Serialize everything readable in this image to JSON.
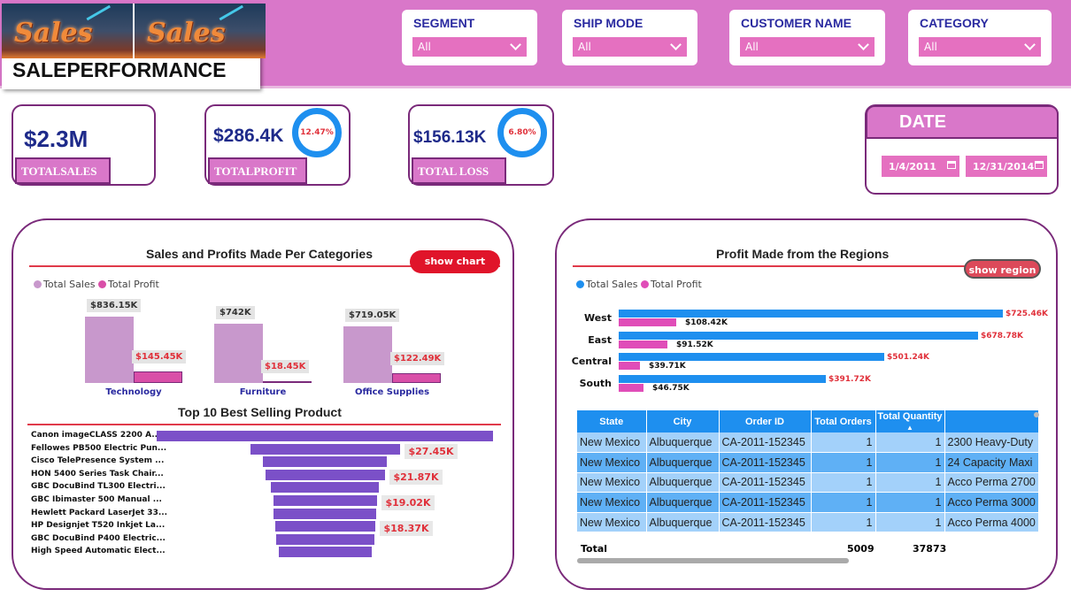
{
  "header": {
    "logo_word": "Sales",
    "title": "SALEPERFORMANCE",
    "slicers": [
      {
        "label": "SEGMENT",
        "value": "All"
      },
      {
        "label": "SHIP MODE",
        "value": "All"
      },
      {
        "label": "CUSTOMER NAME",
        "value": "All"
      },
      {
        "label": "CATEGORY",
        "value": "All"
      }
    ]
  },
  "kpis": {
    "sales": {
      "value": "$2.3M",
      "label": "TOTALSALES"
    },
    "profit": {
      "value": "$286.4K",
      "label": "TOTALPROFIT",
      "pct": "12.47%"
    },
    "loss": {
      "value": "$156.13K",
      "label": "TOTAL LOSS",
      "pct": "6.80%"
    }
  },
  "date": {
    "title": "DATE",
    "start": "1/4/2011",
    "end": "12/31/2014"
  },
  "category_panel": {
    "title": "Sales and Profits Made Per Categories",
    "button": "show chart",
    "funnel_title": "Top 10 Best Selling Product"
  },
  "region_panel": {
    "title": "Profit Made from the Regions",
    "button": "show region"
  },
  "colors": {
    "accent": "#d977c9",
    "sales_cat": "#c898cc",
    "profit_cat": "#d94fa8",
    "sales_region": "#1e8fef",
    "profit_region": "#e04db8",
    "funnel": "#7b50c8"
  },
  "chart_data": [
    {
      "type": "bar",
      "title": "Sales and Profits Made Per Categories",
      "categories": [
        "Technology",
        "Furniture",
        "Office Supplies"
      ],
      "series": [
        {
          "name": "Total Sales",
          "values": [
            836150,
            742000,
            719050
          ],
          "labels": [
            "$836.15K",
            "$742K",
            "$719.05K"
          ]
        },
        {
          "name": "Total Profit",
          "values": [
            145450,
            18450,
            122490
          ],
          "labels": [
            "$145.45K",
            "$18.45K",
            "$122.49K"
          ]
        }
      ],
      "legend": "top-left"
    },
    {
      "type": "bar",
      "title": "Profit Made from the Regions",
      "orientation": "horizontal",
      "categories": [
        "West",
        "East",
        "Central",
        "South"
      ],
      "series": [
        {
          "name": "Total Sales",
          "values": [
            725460,
            678780,
            501240,
            391720
          ],
          "labels": [
            "$725.46K",
            "$678.78K",
            "$501.24K",
            "$391.72K"
          ]
        },
        {
          "name": "Total Profit",
          "values": [
            108420,
            91520,
            39710,
            46750
          ],
          "labels": [
            "$108.42K",
            "$91.52K",
            "$39.71K",
            "$46.75K"
          ]
        }
      ],
      "legend": "top-left"
    },
    {
      "type": "bar",
      "title": "Top 10 Best Selling Product",
      "orientation": "funnel",
      "categories": [
        "Canon imageCLASS 2200 A...",
        "Fellowes PB500 Electric Pun...",
        "Cisco TelePresence System ...",
        "HON 5400 Series Task Chair...",
        "GBC DocuBind TL300 Electri...",
        "GBC Ibimaster 500 Manual ...",
        "Hewlett Packard LaserJet 33...",
        "HP Designjet T520 Inkjet La...",
        "GBC DocuBind P400 Electric...",
        "High Speed Automatic Elect..."
      ],
      "values": [
        61600,
        27450,
        22640,
        21870,
        19820,
        19020,
        18840,
        18370,
        17970,
        17030
      ],
      "labels": [
        "",
        "$27.45K",
        "",
        "$21.87K",
        "",
        "$19.02K",
        "",
        "$18.37K",
        "",
        ""
      ]
    }
  ],
  "table": {
    "headers": [
      "State",
      "City",
      "Order ID",
      "Total Orders",
      "Total Quantity",
      ""
    ],
    "rows": [
      [
        "New Mexico",
        "Albuquerque",
        "CA-2011-152345",
        "1",
        "1",
        "2300 Heavy-Duty"
      ],
      [
        "New Mexico",
        "Albuquerque",
        "CA-2011-152345",
        "1",
        "1",
        "24 Capacity Maxi"
      ],
      [
        "New Mexico",
        "Albuquerque",
        "CA-2011-152345",
        "1",
        "1",
        "Acco Perma 2700"
      ],
      [
        "New Mexico",
        "Albuquerque",
        "CA-2011-152345",
        "1",
        "1",
        "Acco Perma 3000"
      ],
      [
        "New Mexico",
        "Albuquerque",
        "CA-2011-152345",
        "1",
        "1",
        "Acco Perma 4000"
      ]
    ],
    "total_label": "Total",
    "total_orders": "5009",
    "total_quantity": "37873"
  }
}
